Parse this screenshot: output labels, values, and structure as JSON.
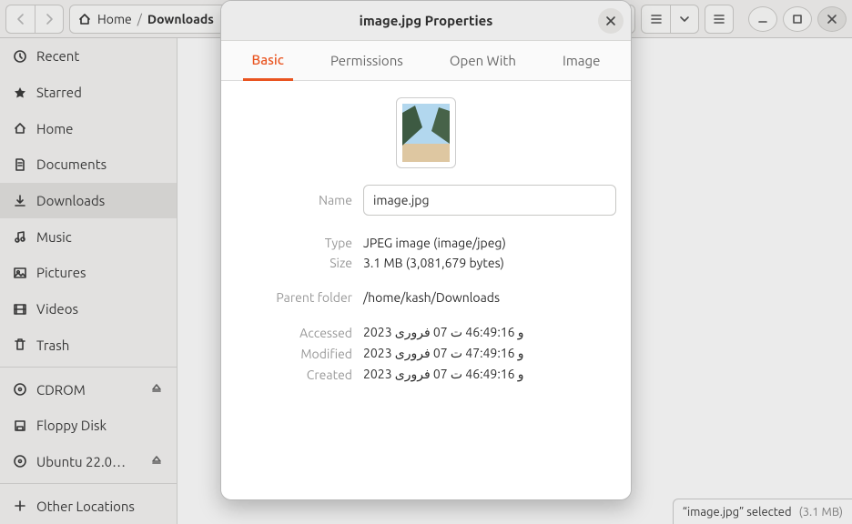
{
  "path": {
    "root": "Home",
    "current": "Downloads"
  },
  "sidebar": {
    "items": [
      {
        "label": "Recent"
      },
      {
        "label": "Starred"
      },
      {
        "label": "Home"
      },
      {
        "label": "Documents"
      },
      {
        "label": "Downloads"
      },
      {
        "label": "Music"
      },
      {
        "label": "Pictures"
      },
      {
        "label": "Videos"
      },
      {
        "label": "Trash"
      }
    ],
    "devices": [
      {
        "label": "CDROM"
      },
      {
        "label": "Floppy Disk"
      },
      {
        "label": "Ubuntu 22.0…"
      }
    ],
    "other": "Other Locations"
  },
  "statusbar": {
    "text": "“image.jpg” selected",
    "size": "(3.1 MB)"
  },
  "dialog": {
    "title": "image.jpg Properties",
    "tabs": [
      "Basic",
      "Permissions",
      "Open With",
      "Image"
    ],
    "fields": {
      "name_label": "Name",
      "name_value": "image.jpg",
      "type_label": "Type",
      "type_value": "JPEG image (image/jpeg)",
      "size_label": "Size",
      "size_value": "3.1 MB (3,081,679 bytes)",
      "parent_label": "Parent folder",
      "parent_value": "/home/kash/Downloads",
      "accessed_label": "Accessed",
      "accessed_value": "و 46:49:16 ت 07 فروری 2023",
      "modified_label": "Modified",
      "modified_value": "و 47:49:16 ت 07 فروری 2023",
      "created_label": "Created",
      "created_value": "و 46:49:16 ت 07 فروری 2023"
    }
  }
}
